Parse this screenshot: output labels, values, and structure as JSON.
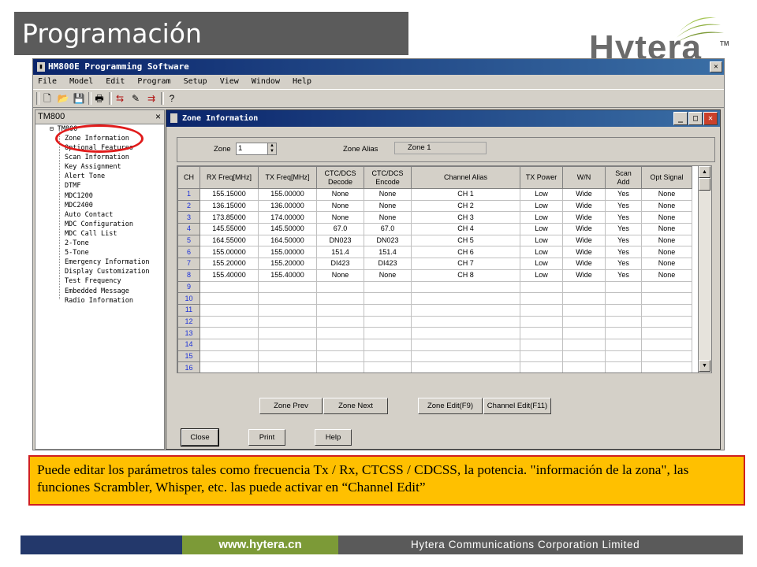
{
  "slide": {
    "title": "Programación",
    "logo_text": "Hytera",
    "logo_tm": "TM",
    "note": "Puede editar los parámetros tales como frecuencia Tx / Rx, CTCSS / CDCSS, la potencia. \"información de la zona\", las funciones  Scrambler, Whisper, etc.  las puede activar en  “Channel Edit”",
    "footer_url": "www.hytera.cn",
    "footer_company": "Hytera Communications Corporation Limited"
  },
  "app": {
    "title": "HM800E Programming Software",
    "menu": [
      "File",
      "Model",
      "Edit",
      "Program",
      "Setup",
      "View",
      "Window",
      "Help"
    ],
    "toolbar_icons": [
      "new-icon",
      "open-icon",
      "save-icon",
      "print-icon",
      "read-icon",
      "write-icon",
      "clone-icon",
      "help-icon"
    ]
  },
  "tree": {
    "header": "TM800",
    "close": "×",
    "root": "TM800",
    "items": [
      "Zone Information",
      "Optional Features",
      "Scan Information",
      "Key Assignment",
      "Alert Tone",
      "DTMF",
      "MDC1200",
      "MDC2400",
      "Auto Contact",
      "MDC Configuration",
      "MDC Call List",
      "2-Tone",
      "5-Tone",
      "Emergency Information",
      "Display Customization",
      "Test Frequency",
      "Embedded Message",
      "Radio Information"
    ]
  },
  "dialog": {
    "title": "Zone Information",
    "zone_label": "Zone",
    "zone_value": "1",
    "alias_label": "Zone Alias",
    "alias_value": "Zone 1",
    "columns": [
      "CH",
      "RX Freq[MHz]",
      "TX Freq[MHz]",
      "CTC/DCS Decode",
      "CTC/DCS Encode",
      "Channel Alias",
      "TX Power",
      "W/N",
      "Scan Add",
      "Opt Signal"
    ],
    "rows": [
      [
        "1",
        "155.15000",
        "155.00000",
        "None",
        "None",
        "CH 1",
        "Low",
        "Wide",
        "Yes",
        "None"
      ],
      [
        "2",
        "136.15000",
        "136.00000",
        "None",
        "None",
        "CH 2",
        "Low",
        "Wide",
        "Yes",
        "None"
      ],
      [
        "3",
        "173.85000",
        "174.00000",
        "None",
        "None",
        "CH 3",
        "Low",
        "Wide",
        "Yes",
        "None"
      ],
      [
        "4",
        "145.55000",
        "145.50000",
        "67.0",
        "67.0",
        "CH 4",
        "Low",
        "Wide",
        "Yes",
        "None"
      ],
      [
        "5",
        "164.55000",
        "164.50000",
        "DN023",
        "DN023",
        "CH 5",
        "Low",
        "Wide",
        "Yes",
        "None"
      ],
      [
        "6",
        "155.00000",
        "155.00000",
        "151.4",
        "151.4",
        "CH 6",
        "Low",
        "Wide",
        "Yes",
        "None"
      ],
      [
        "7",
        "155.20000",
        "155.20000",
        "DI423",
        "DI423",
        "CH 7",
        "Low",
        "Wide",
        "Yes",
        "None"
      ],
      [
        "8",
        "155.40000",
        "155.40000",
        "None",
        "None",
        "CH 8",
        "Low",
        "Wide",
        "Yes",
        "None"
      ],
      [
        "9",
        "",
        "",
        "",
        "",
        "",
        "",
        "",
        "",
        ""
      ],
      [
        "10",
        "",
        "",
        "",
        "",
        "",
        "",
        "",
        "",
        ""
      ],
      [
        "11",
        "",
        "",
        "",
        "",
        "",
        "",
        "",
        "",
        ""
      ],
      [
        "12",
        "",
        "",
        "",
        "",
        "",
        "",
        "",
        "",
        ""
      ],
      [
        "13",
        "",
        "",
        "",
        "",
        "",
        "",
        "",
        "",
        ""
      ],
      [
        "14",
        "",
        "",
        "",
        "",
        "",
        "",
        "",
        "",
        ""
      ],
      [
        "15",
        "",
        "",
        "",
        "",
        "",
        "",
        "",
        "",
        ""
      ],
      [
        "16",
        "",
        "",
        "",
        "",
        "",
        "",
        "",
        "",
        ""
      ]
    ],
    "buttons": {
      "zone_prev": "Zone Prev",
      "zone_next": "Zone Next",
      "zone_edit": "Zone Edit(F9)",
      "channel_edit": "Channel Edit(F11)",
      "close": "Close",
      "print": "Print",
      "help": "Help"
    }
  }
}
